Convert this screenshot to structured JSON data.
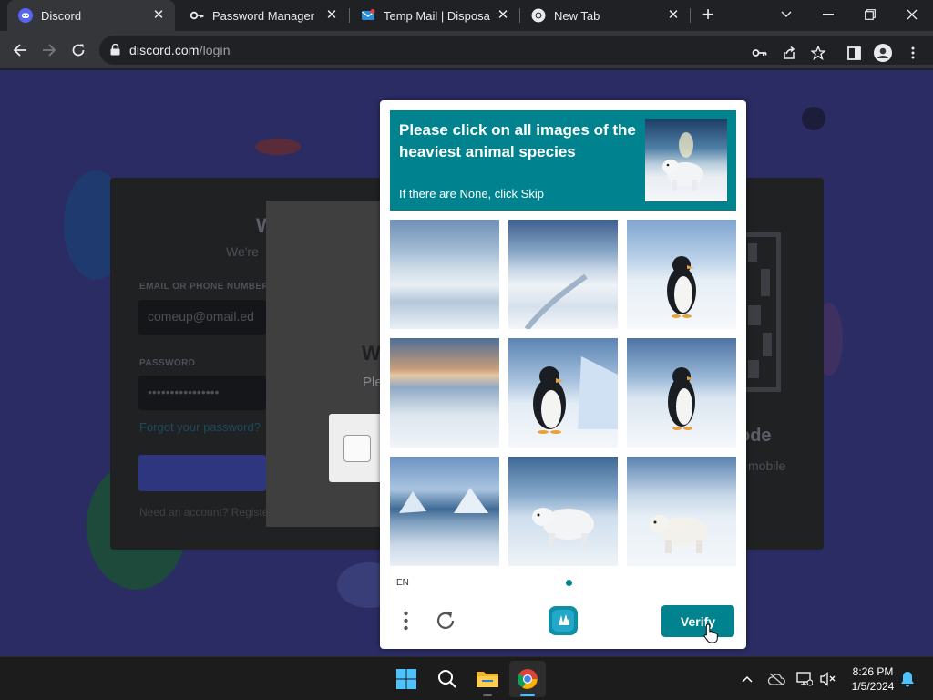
{
  "browser": {
    "tabs": [
      {
        "title": "Discord",
        "icon": "discord-icon",
        "active": true
      },
      {
        "title": "Password Manager",
        "icon": "key-icon",
        "active": false
      },
      {
        "title": "Temp Mail | Disposable",
        "icon": "mail-icon",
        "active": false
      },
      {
        "title": "New Tab",
        "icon": "chrome-icon",
        "active": false
      }
    ],
    "new_tab_label": "+",
    "url_domain": "discord.com",
    "url_path": "/login"
  },
  "login_page": {
    "heading": "W",
    "subheading": "We're",
    "email_label": "EMAIL OR PHONE NUMBER",
    "email_value": "comeup@omail.ed",
    "password_label": "PASSWORD",
    "password_value": "••••••••••••••••",
    "forgot_link": "Forgot your password?",
    "register_text": "Need an account? Register",
    "qr_title": "ode",
    "qr_sub": "mobile"
  },
  "captcha_modal": {
    "heading": "W",
    "subheading": "Ple"
  },
  "challenge": {
    "prompt": "Please click on all images of the heaviest animal species",
    "hint": "If there are None, click Skip",
    "prompt_image": "polar-bear",
    "tiles": [
      {
        "subject": "snow-landscape"
      },
      {
        "subject": "snowy-path"
      },
      {
        "subject": "penguin"
      },
      {
        "subject": "ice-sunset"
      },
      {
        "subject": "penguin"
      },
      {
        "subject": "penguin"
      },
      {
        "subject": "icebergs"
      },
      {
        "subject": "polar-bear"
      },
      {
        "subject": "polar-bear"
      }
    ],
    "language": "EN",
    "verify_label": "Verify",
    "accent_color": "#00838f"
  },
  "taskbar": {
    "apps": [
      "start",
      "search",
      "file-explorer",
      "chrome"
    ],
    "time": "8:26 PM",
    "date": "1/5/2024"
  }
}
